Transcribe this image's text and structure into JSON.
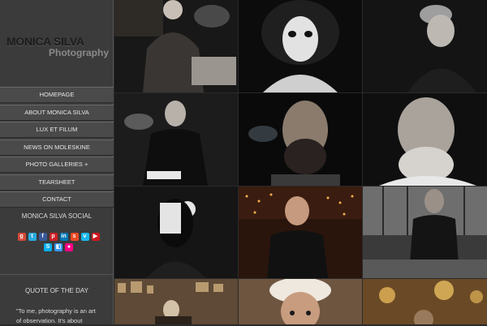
{
  "logo": {
    "name": "MONICA SILVA",
    "subtitle": "Photography"
  },
  "nav": {
    "items": [
      {
        "label": "HOMEPAGE"
      },
      {
        "label": "ABOUT MONICA SILVA"
      },
      {
        "label": "LUX ET FILUM"
      },
      {
        "label": "NEWS ON MOLESKINE"
      },
      {
        "label": "PHOTO GALLERIES  +"
      },
      {
        "label": "TEARSHEET"
      },
      {
        "label": "CONTACT"
      }
    ]
  },
  "social": {
    "title": "MONICA SILVA SOCIAL",
    "icons": [
      "google-plus",
      "twitter",
      "facebook",
      "pinterest",
      "linkedin",
      "stumbleupon",
      "vimeo",
      "youtube",
      "skype",
      "delicious",
      "flickr"
    ]
  },
  "quote": {
    "title": "QUOTE OF THE DAY",
    "text": "\"To me, photography is an art of observation. It's about"
  },
  "colors": {
    "sidebar": "#3b3b3b",
    "nav_bg": "#4a4a4a",
    "logo_dark": "#1c1c1c",
    "logo_sub": "#8a8a8a"
  }
}
